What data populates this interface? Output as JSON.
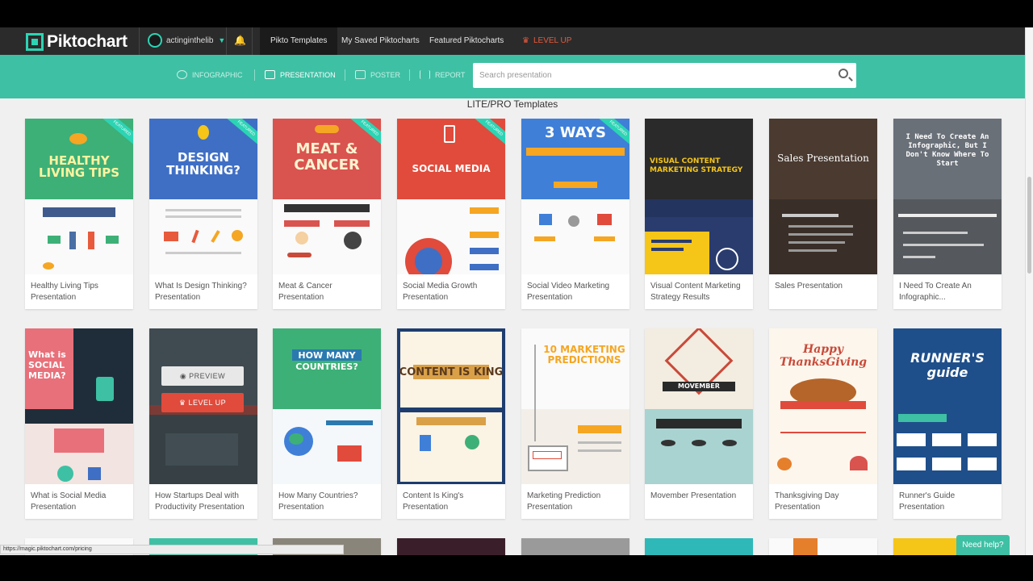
{
  "app": {
    "logo": "Piktochart"
  },
  "nav": {
    "username": "actinginthelib",
    "links": [
      "Pikto Templates",
      "My Saved Piktocharts",
      "Featured Piktocharts"
    ],
    "level_up": "LEVEL UP"
  },
  "types": [
    "INFOGRAPHIC",
    "PRESENTATION",
    "POSTER",
    "REPORT"
  ],
  "search": {
    "placeholder": "Search presentation"
  },
  "section": {
    "title": "LITE/PRO Templates"
  },
  "row1": [
    {
      "name": "Healthy Living Tips Presentation",
      "thumb": "HEALTHY LIVING TIPS"
    },
    {
      "name": "What Is Design Thinking? Presentation",
      "thumb": "DESIGN THINKING?"
    },
    {
      "name": "Meat & Cancer Presentation",
      "thumb": "MEAT & CANCER"
    },
    {
      "name": "Social Media Growth Presentation",
      "thumb": "SOCIAL MEDIA"
    },
    {
      "name": "Social Video Marketing Presentation",
      "thumb": "3 WAYS"
    },
    {
      "name": "Visual Content Marketing Strategy Results",
      "thumb": "VISUAL CONTENT MARKETING STRATEGY"
    },
    {
      "name": "Sales Presentation",
      "thumb": "Sales Presentation"
    },
    {
      "name": "I Need To Create An Infographic...",
      "thumb": "I Need To Create An Infographic, But I Don't Know Where To Start"
    }
  ],
  "row2": [
    {
      "name": "What is Social Media Presentation",
      "thumb": "What is SOCIAL MEDIA?"
    },
    {
      "name": "How Startups Deal with Productivity Presentation",
      "thumb": ""
    },
    {
      "name": "How Many Countries? Presentation",
      "thumb": "HOW MANY COUNTRIES?"
    },
    {
      "name": "Content Is King's Presentation",
      "thumb": "CONTENT IS KING"
    },
    {
      "name": "Marketing Prediction Presentation",
      "thumb": "10 MARKETING PREDICTIONS"
    },
    {
      "name": "Movember Presentation",
      "thumb": "MOVEMBER"
    },
    {
      "name": "Thanksgiving Day Presentation",
      "thumb": "Happy ThanksGiving"
    },
    {
      "name": "Runner's Guide Presentation",
      "thumb": "RUNNER'S guide"
    }
  ],
  "hover": {
    "preview": "PREVIEW",
    "level_up": "LEVEL UP"
  },
  "status_url": "https://magic.piktochart.com/pricing",
  "help": "Need help?"
}
